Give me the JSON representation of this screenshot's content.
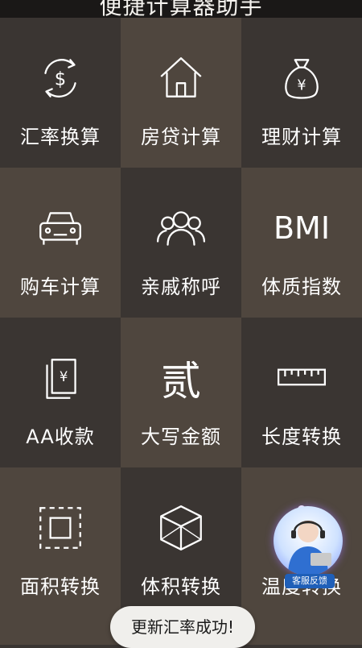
{
  "header": {
    "title": "便捷计算器助手"
  },
  "tiles": [
    {
      "label": "汇率换算",
      "icon": "currency-exchange-icon",
      "bg": "#3a3532"
    },
    {
      "label": "房贷计算",
      "icon": "house-icon",
      "bg": "#4f463e"
    },
    {
      "label": "理财计算",
      "icon": "money-bag-icon",
      "bg": "#3a3532"
    },
    {
      "label": "购车计算",
      "icon": "car-icon",
      "bg": "#4f463e"
    },
    {
      "label": "亲戚称呼",
      "icon": "people-icon",
      "bg": "#3a3532"
    },
    {
      "label": "体质指数",
      "icon": "bmi-icon",
      "icon_text": "BMI",
      "bg": "#4f463e"
    },
    {
      "label": "AA收款",
      "icon": "receipt-yen-icon",
      "bg": "#3a3532"
    },
    {
      "label": "大写金额",
      "icon": "uppercase-number-icon",
      "icon_text": "贰",
      "bg": "#4f463e"
    },
    {
      "label": "长度转换",
      "icon": "ruler-icon",
      "bg": "#3a3532"
    },
    {
      "label": "面积转换",
      "icon": "area-square-icon",
      "bg": "#4f463e"
    },
    {
      "label": "体积转换",
      "icon": "cube-icon",
      "bg": "#3a3532"
    },
    {
      "label": "温度转换",
      "icon": "thermometer-icon",
      "bg": "#4f463e"
    }
  ],
  "toast": {
    "text": "更新汇率成功!"
  },
  "customer_service": {
    "label": "客服反馈",
    "icon": "customer-service-avatar-icon"
  }
}
